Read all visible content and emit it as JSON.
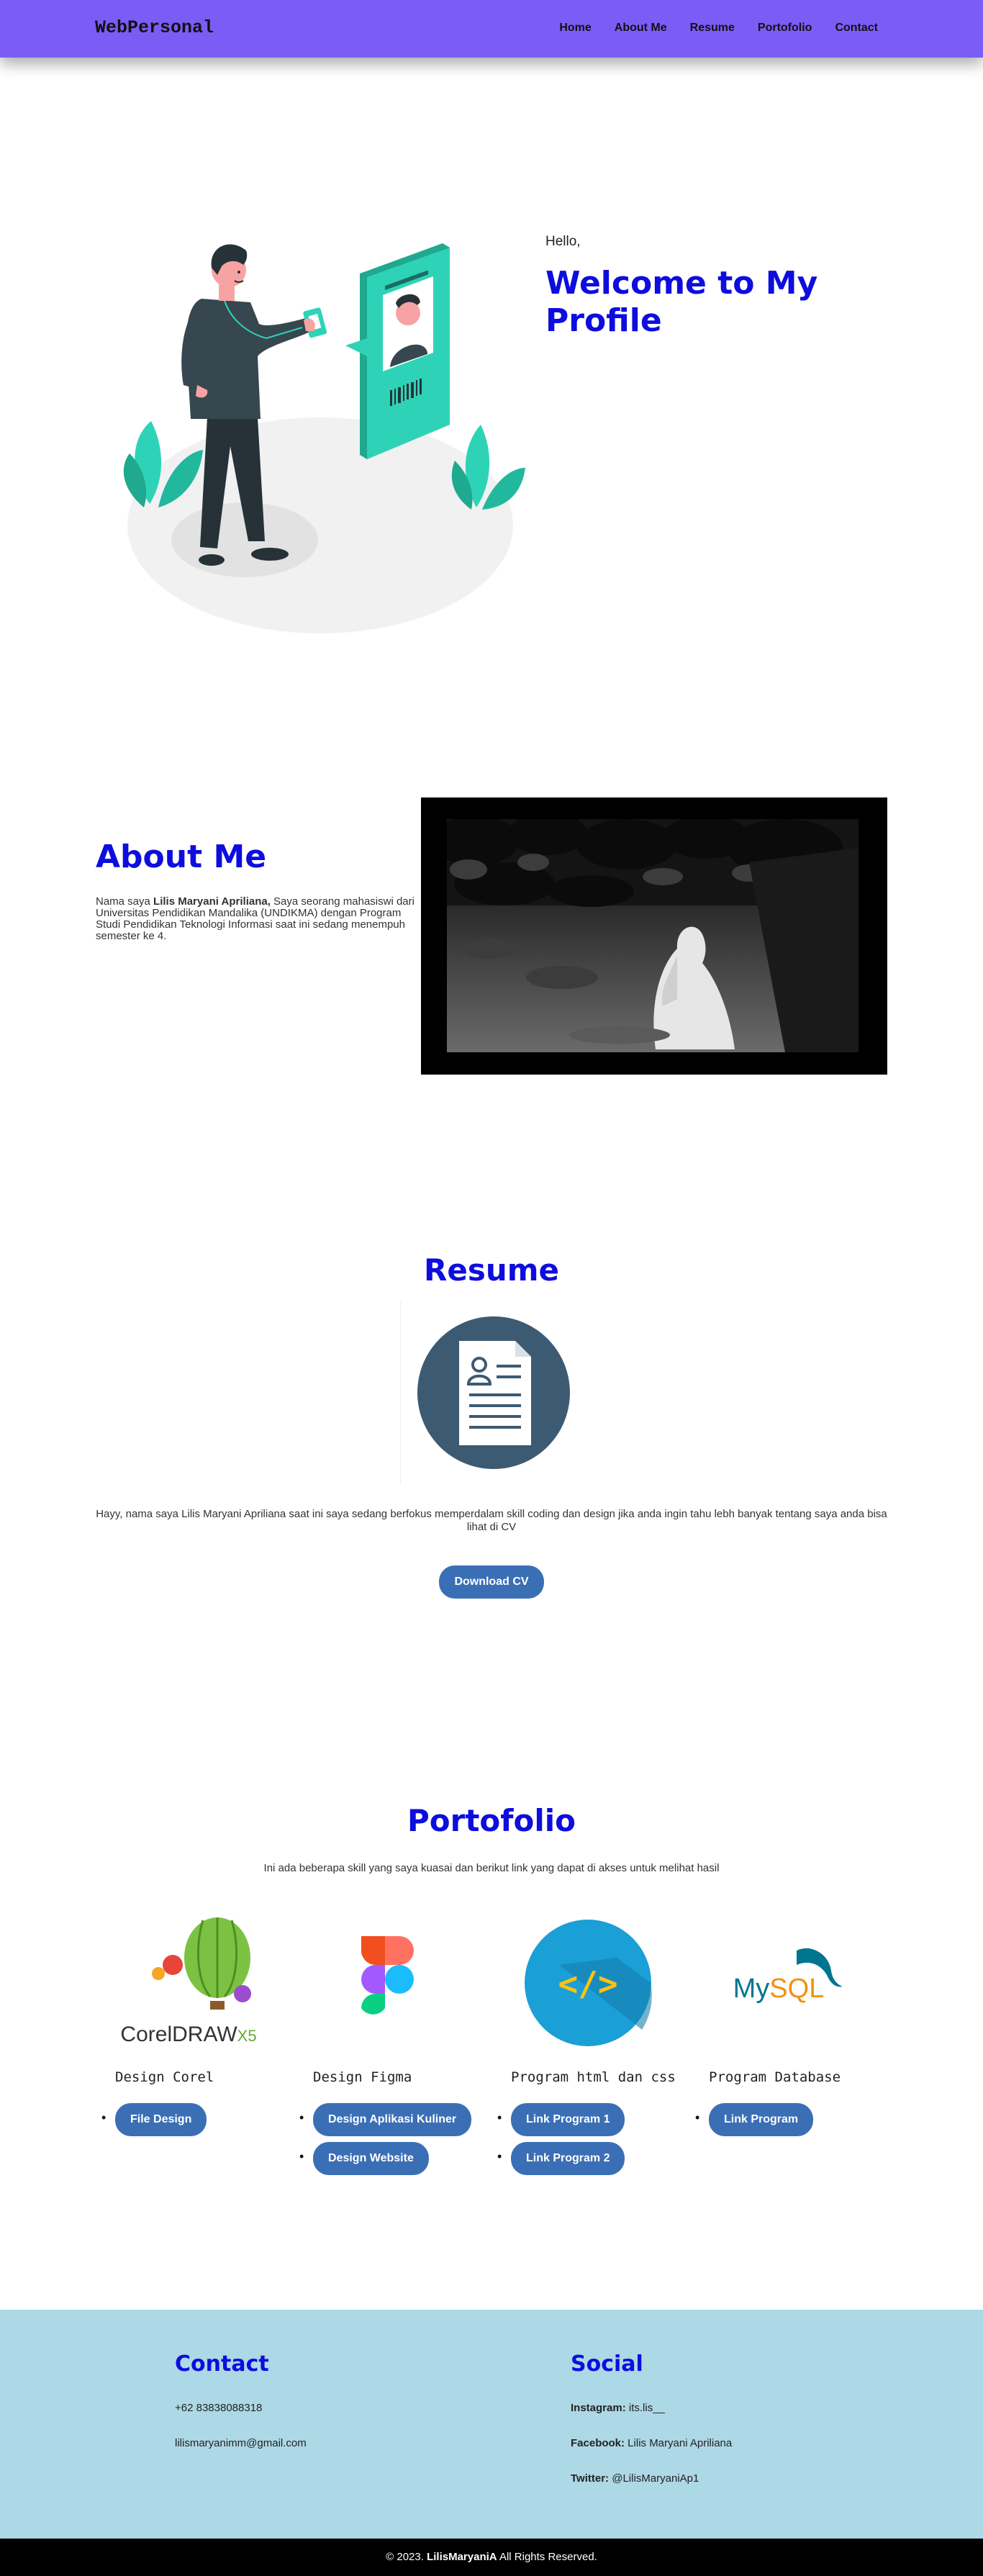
{
  "navbar": {
    "brand": "WebPersonal",
    "links": [
      "Home",
      "About Me",
      "Resume",
      "Portofolio",
      "Contact"
    ]
  },
  "hero": {
    "greeting": "Hello,",
    "title": "Welcome to My Profile"
  },
  "about": {
    "title": "About Me",
    "text_prefix": "Nama saya ",
    "name_bold": "Lilis Maryani Apriliana,",
    "text_suffix": " Saya seorang mahasiswi dari Universitas Pendidikan Mandalika (UNDIKMA) dengan Program Studi Pendidikan Teknologi Informasi saat ini sedang menempuh semester ke 4."
  },
  "resume": {
    "title": "Resume",
    "text": "Hayy, nama saya Lilis Maryani Apriliana saat ini saya sedang berfokus memperdalam skill coding dan design jika anda ingin tahu lebh banyak tentang saya anda bisa lihat di CV",
    "button": "Download CV"
  },
  "portfolio": {
    "title": "Portofolio",
    "subtitle": "Ini ada beberapa skill yang saya kuasai dan berikut link yang dapat di akses untuk melihat hasil",
    "cards": [
      {
        "title": "Design Corel",
        "links": [
          "File Design"
        ],
        "logo_text": "CorelDRAW",
        "logo_suffix": "X5"
      },
      {
        "title": "Design Figma",
        "links": [
          "Design Aplikasi Kuliner",
          "Design Website"
        ]
      },
      {
        "title": "Program html dan css",
        "links": [
          "Link Program 1",
          "Link Program 2"
        ],
        "logo_text": "</>"
      },
      {
        "title": "Program Database",
        "links": [
          "Link Program"
        ],
        "logo_text": "My",
        "logo_suffix": "SQL"
      }
    ]
  },
  "footer": {
    "contact_title": "Contact",
    "phone": "+62 83838088318",
    "email": "lilismaryanimm@gmail.com",
    "social_title": "Social",
    "instagram_label": "Instagram:",
    "instagram": " its.lis__",
    "facebook_label": "Facebook:",
    "facebook": " Lilis Maryani Apriliana",
    "twitter_label": "Twitter:",
    "twitter": " @LilisMaryaniAp1",
    "copyright_prefix": "© 2023. ",
    "copyright_name": "LilisMaryaniA",
    "copyright_suffix": " All Rights Reserved."
  },
  "colors": {
    "navbar": "#7b5cf5",
    "title_blue": "#0d0dde",
    "button": "#3b6fb5",
    "footer_bg": "#add8e6",
    "accent_teal": "#2ed3b7"
  }
}
